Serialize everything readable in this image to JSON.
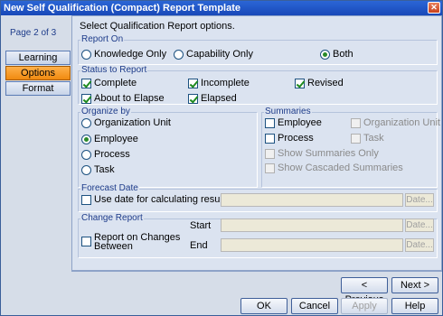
{
  "window": {
    "title": "New Self Qualification (Compact) Report Template",
    "close_glyph": "✕"
  },
  "nav": {
    "page_indicator": "Page 2 of 3",
    "items": [
      {
        "label": "Learning",
        "active": false
      },
      {
        "label": "Options",
        "active": true
      },
      {
        "label": "Format",
        "active": false
      }
    ]
  },
  "instruction": "Select Qualification Report options.",
  "report_on": {
    "label": "Report On",
    "options": [
      "Knowledge Only",
      "Capability Only",
      "Both"
    ],
    "selected": "Both"
  },
  "status": {
    "label": "Status to Report",
    "items": [
      {
        "label": "Complete",
        "checked": true
      },
      {
        "label": "Incomplete",
        "checked": true
      },
      {
        "label": "Revised",
        "checked": true
      },
      {
        "label": "About to Elapse",
        "checked": true
      },
      {
        "label": "Elapsed",
        "checked": true
      }
    ]
  },
  "organize_by": {
    "label": "Organize by",
    "options": [
      "Organization Unit",
      "Employee",
      "Process",
      "Task"
    ],
    "selected": "Employee"
  },
  "summaries": {
    "label": "Summaries",
    "items": [
      {
        "label": "Employee",
        "checked": false,
        "enabled": true
      },
      {
        "label": "Organization Unit",
        "checked": false,
        "enabled": false
      },
      {
        "label": "Process",
        "checked": false,
        "enabled": true
      },
      {
        "label": "Task",
        "checked": false,
        "enabled": false
      },
      {
        "label": "Show Summaries Only",
        "checked": false,
        "enabled": false
      },
      {
        "label": "Show Cascaded Summaries",
        "checked": false,
        "enabled": false
      }
    ]
  },
  "forecast": {
    "label": "Forecast Date",
    "use_date_label": "Use date for calculating results",
    "date_value": "",
    "date_button": "Date..."
  },
  "change_report": {
    "label": "Change Report",
    "checkbox_label_line1": "Report on Changes",
    "checkbox_label_line2": "Between",
    "start_label": "Start",
    "end_label": "End",
    "start_value": "",
    "end_value": "",
    "date_button": "Date..."
  },
  "buttons": {
    "previous": "< Previous",
    "next": "Next >",
    "ok": "OK",
    "cancel": "Cancel",
    "apply": "Apply",
    "help": "Help"
  }
}
